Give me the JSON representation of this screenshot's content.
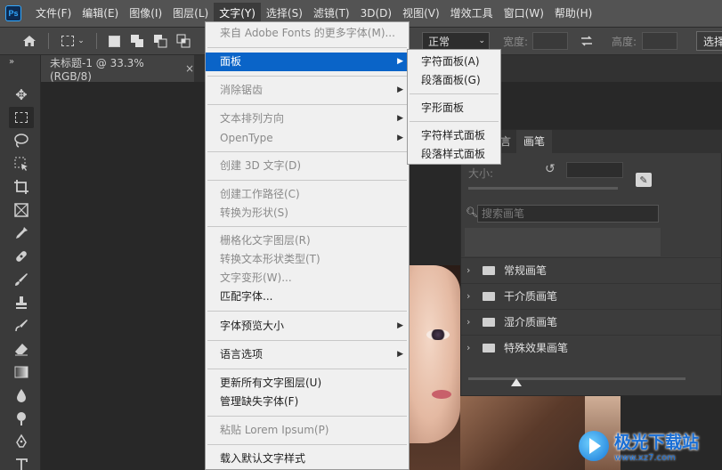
{
  "menubar": {
    "logo": "Ps",
    "items": [
      "文件(F)",
      "编辑(E)",
      "图像(I)",
      "图层(L)",
      "文字(Y)",
      "选择(S)",
      "滤镜(T)",
      "3D(D)",
      "视图(V)",
      "增效工具",
      "窗口(W)",
      "帮助(H)"
    ]
  },
  "options": {
    "mode_value": "正常",
    "width_label": "宽度:",
    "height_label": "高度:",
    "select_button": "选择"
  },
  "document_tab": {
    "title": "未标题-1 @ 33.3%(RGB/8)",
    "close": "×"
  },
  "type_menu": {
    "items": [
      {
        "label": "来自 Adobe Fonts 的更多字体(M)...",
        "disabled": true
      },
      {
        "label": "面板",
        "highlighted": true,
        "submenu": true
      },
      {
        "label": "消除锯齿",
        "disabled": true,
        "submenu": true
      },
      {
        "label": "文本排列方向",
        "disabled": true,
        "submenu": true
      },
      {
        "label": "OpenType",
        "disabled": true,
        "submenu": true
      },
      {
        "label": "创建 3D 文字(D)",
        "disabled": true
      },
      {
        "label": "创建工作路径(C)",
        "disabled": true
      },
      {
        "label": "转换为形状(S)",
        "disabled": true
      },
      {
        "label": "栅格化文字图层(R)",
        "disabled": true
      },
      {
        "label": "转换文本形状类型(T)",
        "disabled": true
      },
      {
        "label": "文字变形(W)...",
        "disabled": true
      },
      {
        "label": "匹配字体...",
        "disabled": false
      },
      {
        "label": "字体预览大小",
        "disabled": false,
        "submenu": true
      },
      {
        "label": "语言选项",
        "disabled": false,
        "submenu": true
      },
      {
        "label": "更新所有文字图层(U)",
        "disabled": false
      },
      {
        "label": "管理缺失字体(F)",
        "disabled": false
      },
      {
        "label": "粘贴 Lorem Ipsum(P)",
        "disabled": true
      },
      {
        "label": "载入默认文字样式",
        "disabled": false
      }
    ]
  },
  "panel_submenu": {
    "items": [
      "字符面板(A)",
      "段落面板(G)",
      "字形面板",
      "字符样式面板",
      "段落样式面板"
    ]
  },
  "brush_panel": {
    "tab_partial": "言",
    "tab_active": "画笔",
    "size_label": "大小:",
    "search_placeholder": "搜索画笔",
    "folders": [
      "常规画笔",
      "干介质画笔",
      "湿介质画笔",
      "特殊效果画笔"
    ]
  },
  "watermark": {
    "title": "极光下载站",
    "url": "www.xz7.com"
  }
}
